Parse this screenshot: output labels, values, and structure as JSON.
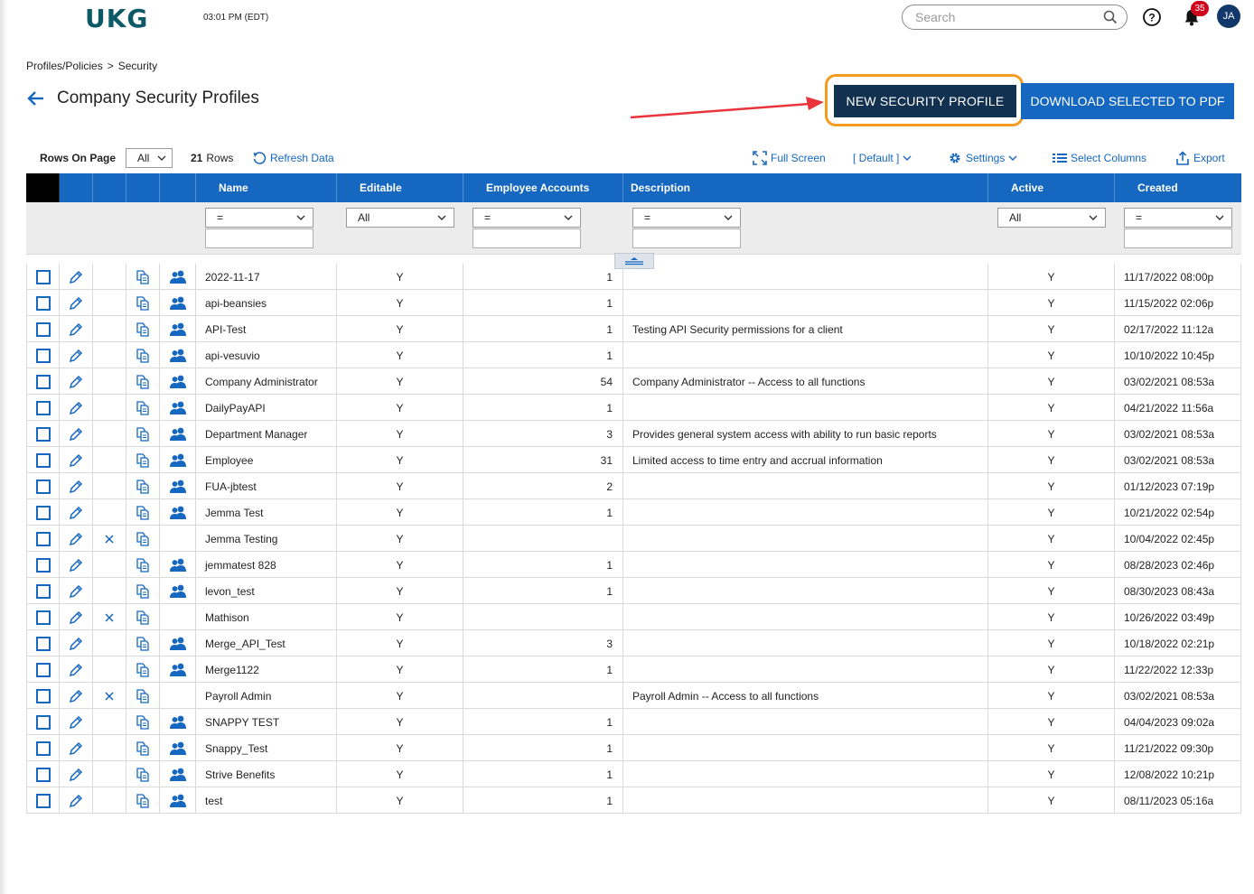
{
  "header": {
    "logo_text": "UKG",
    "time": "03:01 PM (EDT)",
    "search_placeholder": "Search",
    "notification_count": "35",
    "avatar_initials": "JA"
  },
  "breadcrumb": {
    "parent": "Profiles/Policies",
    "separator": ">",
    "current": "Security"
  },
  "page_title": "Company Security Profiles",
  "actions": {
    "new_profile": "NEW SECURITY PROFILE",
    "download_pdf": "DOWNLOAD SELECTED TO PDF"
  },
  "toolbar": {
    "rows_on_page_label": "Rows On Page",
    "rows_on_page_value": "All",
    "row_count": "21",
    "rows_label": "Rows",
    "refresh": "Refresh Data",
    "full_screen": "Full Screen",
    "view": "[ Default ]",
    "settings": "Settings",
    "select_columns": "Select Columns",
    "export": "Export"
  },
  "columns": {
    "name": "Name",
    "editable": "Editable",
    "employee_accounts": "Employee Accounts",
    "description": "Description",
    "active": "Active",
    "created": "Created"
  },
  "filters": {
    "name": "=",
    "editable": "All",
    "employee_accounts": "=",
    "description": "=",
    "active": "All",
    "created": "="
  },
  "colors": {
    "accent": "#1567c0",
    "new_button": "#12304f",
    "highlight": "#f39c1f",
    "annotation_arrow": "#e8343a"
  },
  "rows": [
    {
      "name": "2022-11-17",
      "editable": "Y",
      "accounts": "1",
      "description": "",
      "active": "Y",
      "created": "11/17/2022 08:00p",
      "deletable": false,
      "users": true
    },
    {
      "name": "api-beansies",
      "editable": "Y",
      "accounts": "1",
      "description": "",
      "active": "Y",
      "created": "11/15/2022 02:06p",
      "deletable": false,
      "users": true
    },
    {
      "name": "API-Test",
      "editable": "Y",
      "accounts": "1",
      "description": "Testing API Security permissions for a client",
      "active": "Y",
      "created": "02/17/2022 11:12a",
      "deletable": false,
      "users": true
    },
    {
      "name": "api-vesuvio",
      "editable": "Y",
      "accounts": "1",
      "description": "",
      "active": "Y",
      "created": "10/10/2022 10:45p",
      "deletable": false,
      "users": true
    },
    {
      "name": "Company Administrator",
      "editable": "Y",
      "accounts": "54",
      "description": "Company Administrator -- Access to all functions",
      "active": "Y",
      "created": "03/02/2021 08:53a",
      "deletable": false,
      "users": true
    },
    {
      "name": "DailyPayAPI",
      "editable": "Y",
      "accounts": "1",
      "description": "",
      "active": "Y",
      "created": "04/21/2022 11:56a",
      "deletable": false,
      "users": true
    },
    {
      "name": "Department Manager",
      "editable": "Y",
      "accounts": "3",
      "description": "Provides general system access with ability to run basic reports",
      "active": "Y",
      "created": "03/02/2021 08:53a",
      "deletable": false,
      "users": true
    },
    {
      "name": "Employee",
      "editable": "Y",
      "accounts": "31",
      "description": "Limited access to time entry and accrual information",
      "active": "Y",
      "created": "03/02/2021 08:53a",
      "deletable": false,
      "users": true
    },
    {
      "name": "FUA-jbtest",
      "editable": "Y",
      "accounts": "2",
      "description": "",
      "active": "Y",
      "created": "01/12/2023 07:19p",
      "deletable": false,
      "users": true
    },
    {
      "name": "Jemma Test",
      "editable": "Y",
      "accounts": "1",
      "description": "",
      "active": "Y",
      "created": "10/21/2022 02:54p",
      "deletable": false,
      "users": true
    },
    {
      "name": "Jemma Testing",
      "editable": "Y",
      "accounts": "",
      "description": "",
      "active": "Y",
      "created": "10/04/2022 02:45p",
      "deletable": true,
      "users": false
    },
    {
      "name": "jemmatest 828",
      "editable": "Y",
      "accounts": "1",
      "description": "",
      "active": "Y",
      "created": "08/28/2023 02:46p",
      "deletable": false,
      "users": true
    },
    {
      "name": "levon_test",
      "editable": "Y",
      "accounts": "1",
      "description": "",
      "active": "Y",
      "created": "08/30/2023 08:43a",
      "deletable": false,
      "users": true
    },
    {
      "name": "Mathison",
      "editable": "Y",
      "accounts": "",
      "description": "",
      "active": "Y",
      "created": "10/26/2022 03:49p",
      "deletable": true,
      "users": false
    },
    {
      "name": "Merge_API_Test",
      "editable": "Y",
      "accounts": "3",
      "description": "",
      "active": "Y",
      "created": "10/18/2022 02:21p",
      "deletable": false,
      "users": true
    },
    {
      "name": "Merge1122",
      "editable": "Y",
      "accounts": "1",
      "description": "",
      "active": "Y",
      "created": "11/22/2022 12:33p",
      "deletable": false,
      "users": true
    },
    {
      "name": "Payroll Admin",
      "editable": "Y",
      "accounts": "",
      "description": "Payroll Admin -- Access to all functions",
      "active": "Y",
      "created": "03/02/2021 08:53a",
      "deletable": true,
      "users": false
    },
    {
      "name": "SNAPPY TEST",
      "editable": "Y",
      "accounts": "1",
      "description": "",
      "active": "Y",
      "created": "04/04/2023 09:02a",
      "deletable": false,
      "users": true
    },
    {
      "name": "Snappy_Test",
      "editable": "Y",
      "accounts": "1",
      "description": "",
      "active": "Y",
      "created": "11/21/2022 09:30p",
      "deletable": false,
      "users": true
    },
    {
      "name": "Strive Benefits",
      "editable": "Y",
      "accounts": "1",
      "description": "",
      "active": "Y",
      "created": "12/08/2022 10:21p",
      "deletable": false,
      "users": true
    },
    {
      "name": "test",
      "editable": "Y",
      "accounts": "1",
      "description": "",
      "active": "Y",
      "created": "08/11/2023 05:16a",
      "deletable": false,
      "users": true
    }
  ]
}
